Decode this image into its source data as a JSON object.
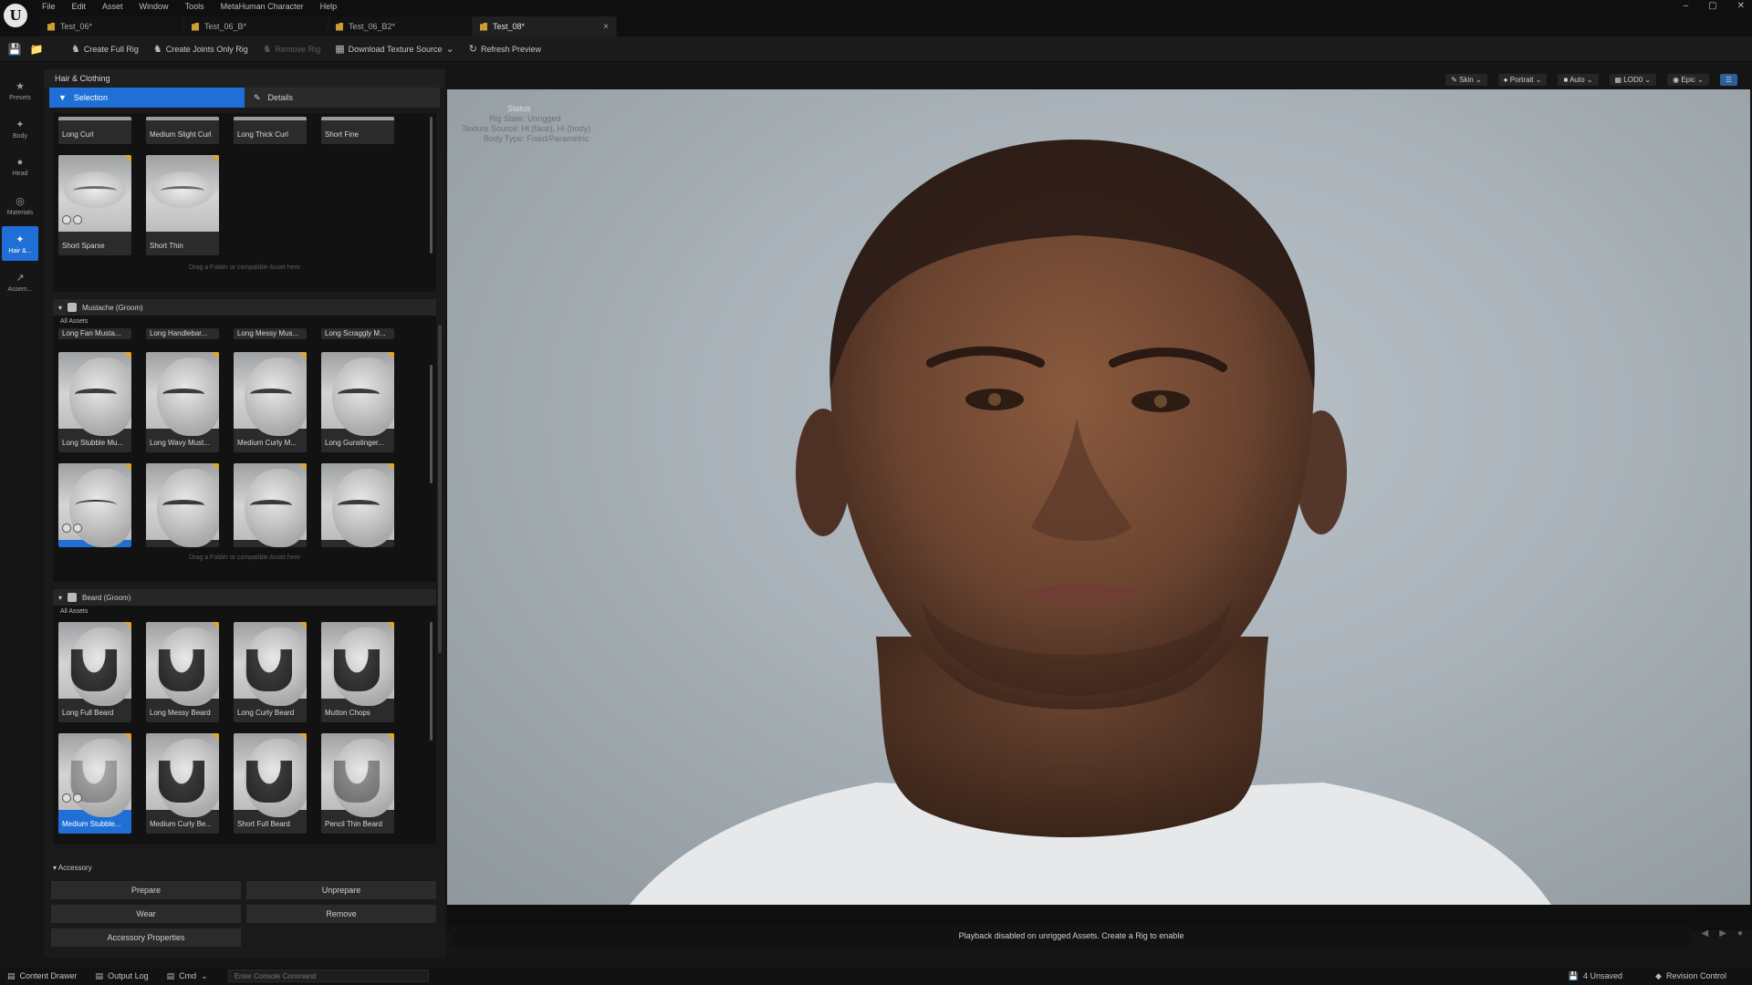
{
  "menu": [
    "File",
    "Edit",
    "Asset",
    "Window",
    "Tools",
    "MetaHuman Character",
    "Help"
  ],
  "tabs": [
    {
      "label": "Test_06*",
      "active": false
    },
    {
      "label": "Test_06_B*",
      "active": false
    },
    {
      "label": "Test_06_B2*",
      "active": false
    },
    {
      "label": "Test_08*",
      "active": true
    }
  ],
  "tab_close": "×",
  "window_controls": [
    "–",
    "▢",
    "✕"
  ],
  "toolbar": {
    "create_full_rig": "Create Full Rig",
    "create_joints_only_rig": "Create Joints Only Rig",
    "remove_rig": "Remove Rig",
    "download_texture_source": "Download Texture Source",
    "refresh_preview": "Refresh Preview"
  },
  "modes": [
    {
      "label": "Presets",
      "icon": "star-icon"
    },
    {
      "label": "Body",
      "icon": "body-icon"
    },
    {
      "label": "Head",
      "icon": "head-icon"
    },
    {
      "label": "Materials",
      "icon": "materials-icon"
    },
    {
      "label": "Hair &...",
      "icon": "hair-icon",
      "active": true
    },
    {
      "label": "Assem...",
      "icon": "assembly-icon"
    }
  ],
  "panel": {
    "title": "Hair & Clothing",
    "tab_selection": "Selection",
    "tab_details": "Details",
    "drop_hint": "Drag a Folder or compatible Asset here",
    "eyebrows_top_row": [
      "Long Curl",
      "Medium Slight Curl",
      "Long Thick Curl",
      "Short Fine"
    ],
    "eyebrows": [
      {
        "label": "Short Sparse",
        "badges": true
      },
      {
        "label": "Short Thin",
        "badges": false
      }
    ],
    "mustache_header": "Mustache (Groom)",
    "all_assets": "All Assets",
    "mustache_partial": [
      "Long Fan Musta...",
      "Long Handlebar...",
      "Long Messy Mus...",
      "Long Scraggly M..."
    ],
    "mustache": [
      {
        "label": "Long Stubble Mu..."
      },
      {
        "label": "Long Wavy Must..."
      },
      {
        "label": "Medium Curly M..."
      },
      {
        "label": "Long Gunslinger..."
      },
      {
        "label": "",
        "selected": true,
        "badges": true
      },
      {
        "label": ""
      },
      {
        "label": ""
      },
      {
        "label": ""
      }
    ],
    "beard_header": "Beard (Groom)",
    "beard": [
      {
        "label": "Long Full Beard"
      },
      {
        "label": "Long Messy Beard"
      },
      {
        "label": "Long Curly Beard"
      },
      {
        "label": "Mutton Chops"
      },
      {
        "label": "Medium Stubble...",
        "selected": true,
        "badges": true
      },
      {
        "label": "Medium Curly Be..."
      },
      {
        "label": "Short Full Beard"
      },
      {
        "label": "Pencil Thin Beard"
      }
    ]
  },
  "accessory": {
    "header": "Accessory",
    "prepare": "Prepare",
    "unprepare": "Unprepare",
    "wear": "Wear",
    "remove": "Remove",
    "properties": "Accessory Properties"
  },
  "viewport_bar": [
    "Skin",
    "Portrait",
    "Auto",
    "LOD0",
    "Epic"
  ],
  "status_overlay": {
    "title": "Status",
    "lines": [
      "Rig State: Unrigged",
      "Texture Source: Hi (face), Hi (body)",
      "Body Type: Fixed/Parametric"
    ]
  },
  "playback_message": "Playback disabled on unrigged Assets. Create a Rig to enable",
  "statusbar": {
    "content_drawer": "Content Drawer",
    "output_log": "Output Log",
    "cmd": "Cmd",
    "console_placeholder": "Enter Console Command",
    "unsaved": "4 Unsaved",
    "revision_control": "Revision Control"
  },
  "colors": {
    "accent": "#1f6fd6",
    "badge": "#e0a52a"
  }
}
